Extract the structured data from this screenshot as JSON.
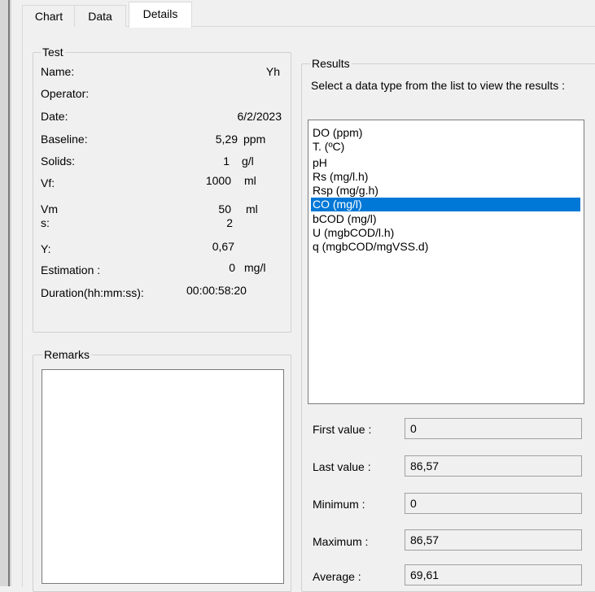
{
  "tabs": [
    {
      "label": "Chart",
      "active": false
    },
    {
      "label": "Data",
      "active": false
    },
    {
      "label": "Details",
      "active": true
    }
  ],
  "test": {
    "group_title": "Test",
    "name_label": "Name:",
    "name_value": "Yh",
    "operator_label": "Operator:",
    "date_label": "Date:",
    "date_value": "6/2/2023",
    "baseline_label": "Baseline:",
    "baseline_value": "5,29",
    "baseline_unit": "ppm",
    "solids_label": "Solids:",
    "solids_value": "1",
    "solids_unit": "g/l",
    "vf_label": "Vf:",
    "vf_value": "1000",
    "vf_unit": "ml",
    "vm_label": "Vm",
    "vm_value": "50",
    "vm_unit": "ml",
    "s_label": "s:",
    "s_value": "2",
    "y_label": "Y:",
    "y_value": "0,67",
    "estimation_label": "Estimation :",
    "estimation_value": "0",
    "estimation_unit": "mg/l",
    "duration_label": "Duration(hh:mm:ss):",
    "duration_value": "00:00:58:20"
  },
  "remarks": {
    "group_title": "Remarks",
    "text": ""
  },
  "results": {
    "group_title": "Results",
    "instruction": "Select a data type from the list to view the results :",
    "items": [
      "DO (ppm)",
      "T. (ºC)",
      "pH",
      "Rs (mg/l.h)",
      "Rsp (mg/g.h)",
      "CO (mg/l)",
      "bCOD (mg/l)",
      "U (mgbCOD/l.h)",
      "q (mgbCOD/mgVSS.d)"
    ],
    "selected_index": 5,
    "first_value_label": "First value :",
    "first_value": "0",
    "last_value_label": "Last value :",
    "last_value": "86,57",
    "minimum_label": "Minimum :",
    "minimum": "0",
    "maximum_label": "Maximum :",
    "maximum": "86,57",
    "average_label": "Average :",
    "average": "69,61"
  },
  "colors": {
    "selection": "#0078d7",
    "window_bg": "#f0f0f0"
  }
}
